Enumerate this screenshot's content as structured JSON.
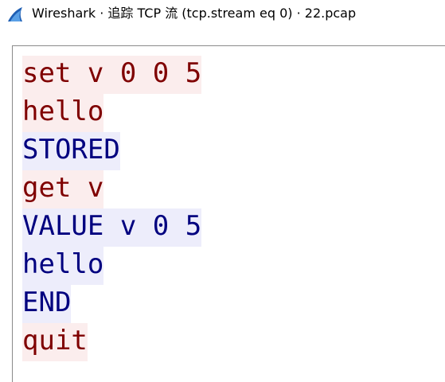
{
  "window": {
    "title": "Wireshark · 追踪 TCP 流 (tcp.stream eq 0) · 22.pcap",
    "icon": "wireshark-fin-icon"
  },
  "colors": {
    "client_text": "#7f0000",
    "client_bg": "#fbeded",
    "server_text": "#00007f",
    "server_bg": "#ededfb"
  },
  "stream": {
    "lines": [
      {
        "side": "client",
        "text": "set v 0 0 5"
      },
      {
        "side": "client",
        "text": "hello"
      },
      {
        "side": "server",
        "text": "STORED"
      },
      {
        "side": "client",
        "text": "get v"
      },
      {
        "side": "server",
        "text": "VALUE v 0 5"
      },
      {
        "side": "server",
        "text": "hello"
      },
      {
        "side": "server",
        "text": "END"
      },
      {
        "side": "client",
        "text": "quit"
      }
    ]
  }
}
